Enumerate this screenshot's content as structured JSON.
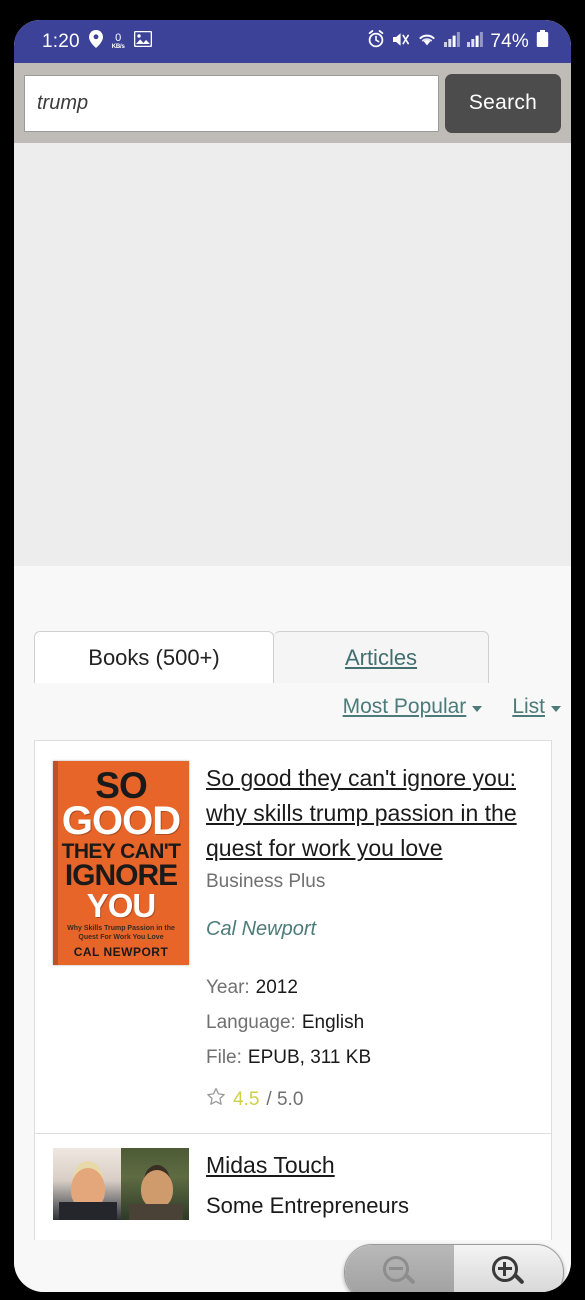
{
  "statusbar": {
    "time": "1:20",
    "network_speed_value": "0",
    "network_speed_unit": "KB/s",
    "battery_percent": "74%",
    "icons": [
      "location-pin-icon",
      "gallery-icon",
      "alarm-icon",
      "mute-icon",
      "wifi-icon",
      "signal-icon",
      "signal-icon-2",
      "battery-icon"
    ]
  },
  "search": {
    "query": "trump",
    "placeholder": "trump",
    "button_label": "Search"
  },
  "tabs": [
    {
      "label": "Books (500+)",
      "active": true
    },
    {
      "label": "Articles",
      "active": false
    }
  ],
  "sort": {
    "order_label": "Most Popular",
    "view_label": "List"
  },
  "results": [
    {
      "title": "So good they can't ignore you: why skills trump passion in the quest for work you love",
      "publisher": "Business Plus",
      "author": "Cal Newport",
      "year_label": "Year:",
      "year_value": "2012",
      "language_label": "Language:",
      "language_value": "English",
      "file_label": "File:",
      "file_value": "EPUB, 311 KB",
      "rating_score": "4.5",
      "rating_outof": "/ 5.0",
      "cover": {
        "line1": "SO",
        "line2": "GOOD",
        "line3": "THEY CAN'T",
        "line4": "IGNORE",
        "line5": "YOU",
        "subtitle": "Why Skills Trump Passion in the Quest For Work You Love",
        "author": "CAL NEWPORT"
      }
    },
    {
      "title": "Midas Touch",
      "publisher": "Some Entrepreneurs"
    }
  ],
  "zoom_control": {
    "zoom_out_label": "zoom-out",
    "zoom_in_label": "zoom-in"
  },
  "colors": {
    "statusbar_bg": "#3b4298",
    "search_bar_bg": "#bfbcb8",
    "search_button_bg": "#4c4c4c",
    "link_teal": "#4d7b79",
    "cover_orange": "#e8652a",
    "rating_yellow": "#cdd24a",
    "page_bg": "#f8f8f8",
    "gray_block": "#ededed"
  }
}
